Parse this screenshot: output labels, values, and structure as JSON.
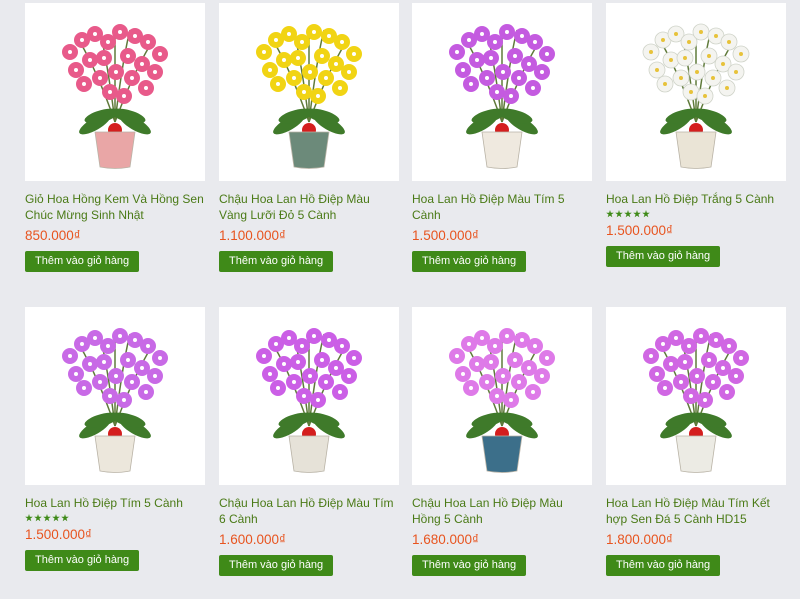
{
  "products": [
    {
      "title": "Giỏ Hoa Hồng Kem Và Hồng Sen Chúc Mừng Sinh Nhật",
      "price": "850.000₫",
      "rating": null,
      "button": "Thêm vào giỏ hàng",
      "flower_color": "#e85a8a",
      "pot_color": "#e9a6a6",
      "image": "rose-basket-icon"
    },
    {
      "title": "Chậu Hoa Lan Hồ Điệp Màu Vàng Lưỡi Đỏ 5 Cành",
      "price": "1.100.000₫",
      "rating": null,
      "button": "Thêm vào giỏ hàng",
      "flower_color": "#f1d414",
      "pot_color": "#6c8a7a",
      "image": "yellow-orchid-pot-icon"
    },
    {
      "title": "Hoa Lan Hồ Điệp Màu Tím 5 Cành",
      "price": "1.500.000₫",
      "rating": null,
      "button": "Thêm vào giỏ hàng",
      "flower_color": "#c45be0",
      "pot_color": "#efe9df",
      "image": "purple-orchid-pot-icon"
    },
    {
      "title": "Hoa Lan Hồ Điệp Trắng 5 Cành",
      "price": "1.500.000₫",
      "rating": "5",
      "button": "Thêm vào giỏ hàng",
      "flower_color": "#f4f4f0",
      "pot_color": "#eae4d6",
      "image": "white-orchid-pot-icon"
    },
    {
      "title": "Hoa Lan Hồ Điệp Tím 5 Cành",
      "price": "1.500.000₫",
      "rating": "5",
      "button": "Thêm vào giỏ hàng",
      "flower_color": "#c86ae6",
      "pot_color": "#ece7dc",
      "image": "purple-orchid-pot-icon"
    },
    {
      "title": "Chậu Hoa Lan Hồ Điệp Màu Tím 6 Cành",
      "price": "1.600.000₫",
      "rating": null,
      "button": "Thêm vào giỏ hàng",
      "flower_color": "#cb5fe6",
      "pot_color": "#e6e2d8",
      "image": "purple-orchid-pot-icon"
    },
    {
      "title": "Chậu Hoa Lan Hồ Điệp Màu Hồng 5 Cành",
      "price": "1.680.000₫",
      "rating": null,
      "button": "Thêm vào giỏ hàng",
      "flower_color": "#de7ae8",
      "pot_color": "#3c6f8a",
      "image": "pink-orchid-pot-icon"
    },
    {
      "title": "Hoa Lan Hồ Điệp Màu Tím Kết hợp Sen Đá 5 Cành HD15",
      "price": "1.800.000₫",
      "rating": null,
      "button": "Thêm vào giỏ hàng",
      "flower_color": "#d067e3",
      "pot_color": "#ecebe4",
      "image": "orchid-succulent-pot-icon"
    }
  ],
  "colors": {
    "title": "#4a7a16",
    "price": "#e8541f",
    "button_bg": "#3f8a18",
    "page_bg": "#e9eaee"
  }
}
